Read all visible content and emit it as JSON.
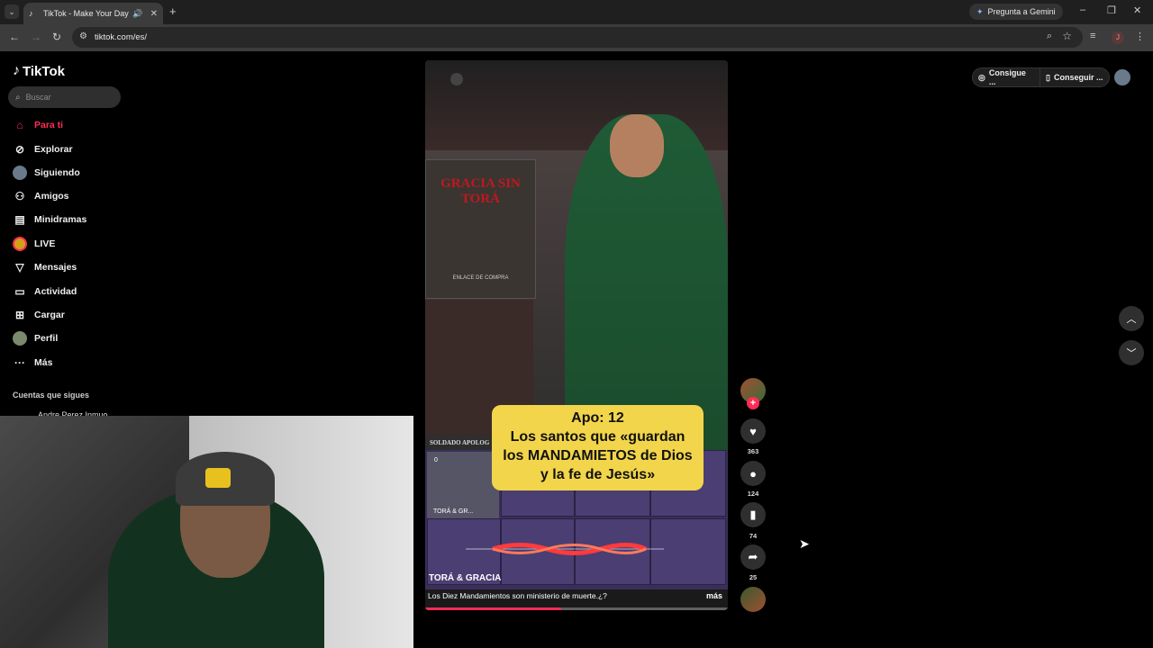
{
  "browser": {
    "tab_title": "TikTok - Make Your Day",
    "url": "tiktok.com/es/",
    "gemini_label": "Pregunta a Gemini",
    "profile_initial": "J"
  },
  "sidebar": {
    "logo": "TikTok",
    "search_placeholder": "Buscar",
    "items": [
      {
        "label": "Para ti",
        "icon": "home-icon"
      },
      {
        "label": "Explorar",
        "icon": "compass-icon"
      },
      {
        "label": "Siguiendo",
        "icon": "avatar-icon"
      },
      {
        "label": "Amigos",
        "icon": "friends-icon"
      },
      {
        "label": "Minidramas",
        "icon": "film-icon"
      },
      {
        "label": "LIVE",
        "icon": "live-icon"
      },
      {
        "label": "Mensajes",
        "icon": "send-icon"
      },
      {
        "label": "Actividad",
        "icon": "inbox-icon"
      },
      {
        "label": "Cargar",
        "icon": "plus-square-icon"
      },
      {
        "label": "Perfil",
        "icon": "profile-avatar-icon"
      },
      {
        "label": "Más",
        "icon": "more-icon"
      }
    ],
    "following_section": "Cuentas que sigues",
    "followed_account": "Andre Perez Inmuo"
  },
  "video": {
    "book_title": "GRACIA SIN TORÁ",
    "book_sub": "ENLACE DE COMPRA",
    "caption_lines": [
      "Apo: 12",
      "Los santos que «guardan",
      "los MANDAMIETOS de Dios",
      "y la fe de Jesús»"
    ],
    "overlay_small": "SOLDADO APOLOG",
    "tile_count": "0",
    "tile_label": "TORÁ & GR...",
    "author": "TORÁ & GRACIA",
    "description": "Los Diez Mandamientos son ministerio de muerte.¿?",
    "more": "más",
    "progress": 0.45
  },
  "actions": {
    "likes": "363",
    "comments": "124",
    "saves": "74",
    "shares": "25"
  },
  "top_right": {
    "get_coins": "Consigue ...",
    "get_app": "Conseguir ..."
  }
}
